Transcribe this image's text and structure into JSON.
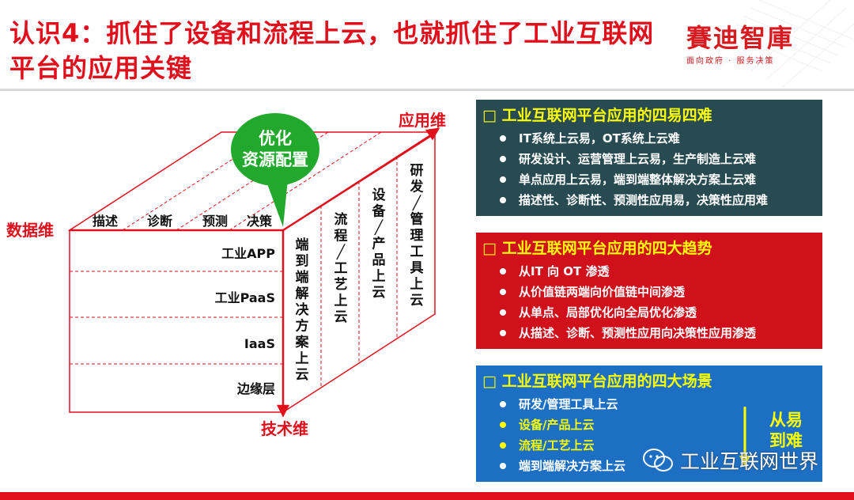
{
  "title": "认识4：抓住了设备和流程上云，也就抓住了工业互联网平台的应用关键",
  "logo": {
    "main": "賽迪智庫",
    "sub": "面向政府 · 服务决策"
  },
  "diagram": {
    "bubble": [
      "优化",
      "资源配置"
    ],
    "axis_data": "数据维",
    "axis_app": "应用维",
    "axis_tech": "技术维",
    "top_labels": [
      "描述",
      "诊断",
      "预测",
      "决策"
    ],
    "layers": [
      "工业APP",
      "工业PaaS",
      "IaaS",
      "边缘层"
    ],
    "side_columns": [
      "端到端解决方案上云",
      "流程/工艺上云",
      "设备/产品上云",
      "研发/管理工具上云"
    ]
  },
  "panels": [
    {
      "title": "□ 工业互联网平台应用的四易四难",
      "items": [
        "IT系统上云易，OT系统上云难",
        "研发设计、运营管理上云易，生产制造上云难",
        "单点应用上云易，端到端整体解决方案上云难",
        "描述性、诊断性、预测性应用易，决策性应用难"
      ]
    },
    {
      "title": "□ 工业互联网平台应用的四大趋势",
      "items": [
        "从IT 向 OT 渗透",
        "从价值链两端向价值链中间渗透",
        "从单点、局部优化向全局优化渗透",
        "从描述、诊断、预测性应用向决策性应用渗透"
      ]
    },
    {
      "title": "□ 工业互联网平台应用的四大场景",
      "items": [
        "研发/管理工具上云",
        "设备/产品上云",
        "流程/工艺上云",
        "端到端解决方案上云"
      ]
    }
  ],
  "arrow_label": [
    "从易",
    "到难"
  ],
  "watermark": "工业互联网世界",
  "colors": {
    "title": "#e0101c",
    "panel1": "#284b52",
    "panel2": "#d0101a",
    "panel3": "#1d6fc4",
    "highlight": "#ffff00",
    "bubble": "#22a82c"
  }
}
